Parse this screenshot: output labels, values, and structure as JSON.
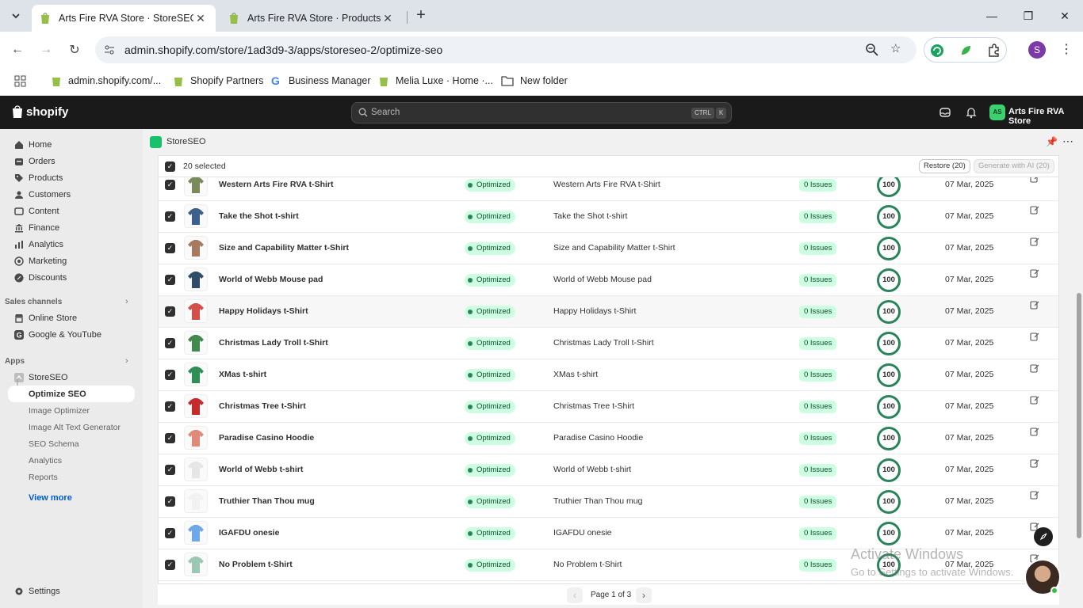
{
  "browser": {
    "tabs": [
      {
        "title": "Arts Fire RVA Store · StoreSEO ·",
        "active": true
      },
      {
        "title": "Arts Fire RVA Store · Products ·",
        "active": false
      }
    ],
    "url": "admin.shopify.com/store/1ad3d9-3/apps/storeseo-2/optimize-seo",
    "profile_initial": "S",
    "bookmarks": [
      {
        "label": "admin.shopify.com/...",
        "icon": "shopify-bag-icon"
      },
      {
        "label": "Shopify Partners",
        "icon": "shopify-bag-icon"
      },
      {
        "label": "Business Manager",
        "icon": "google-g-icon"
      },
      {
        "label": "Melia Luxe · Home ·...",
        "icon": "shopify-bag-icon"
      },
      {
        "label": "New folder",
        "icon": "folder-icon"
      }
    ]
  },
  "shopify": {
    "logo_text": "shopify",
    "search_placeholder": "Search",
    "kbd1": "CTRL",
    "kbd2": "K",
    "store_badge": "AS",
    "store_name": "Arts Fire RVA Store"
  },
  "sidebar": {
    "main": [
      {
        "label": "Home",
        "icon": "home-icon"
      },
      {
        "label": "Orders",
        "icon": "orders-icon"
      },
      {
        "label": "Products",
        "icon": "tag-icon"
      },
      {
        "label": "Customers",
        "icon": "person-icon"
      },
      {
        "label": "Content",
        "icon": "content-icon"
      },
      {
        "label": "Finance",
        "icon": "bank-icon"
      },
      {
        "label": "Analytics",
        "icon": "bar-chart-icon"
      },
      {
        "label": "Marketing",
        "icon": "target-icon"
      },
      {
        "label": "Discounts",
        "icon": "discount-icon"
      }
    ],
    "sales_channels_header": "Sales channels",
    "sales_channels": [
      {
        "label": "Online Store",
        "icon": "store-icon"
      },
      {
        "label": "Google & YouTube",
        "icon": "google-icon"
      }
    ],
    "apps_header": "Apps",
    "app_name": "StoreSEO",
    "app_items": [
      "Optimize SEO",
      "Image Optimizer",
      "Image Alt Text Generator",
      "SEO Schema",
      "Analytics",
      "Reports"
    ],
    "selected_item": "Optimize SEO",
    "view_more": "View more",
    "settings": "Settings"
  },
  "app": {
    "title": "StoreSEO",
    "selected_count": "20 selected",
    "restore_label": "Restore (20)",
    "generate_label": "Generate with AI (20)",
    "status_label": "Optimized",
    "issues_label": "0 Issues",
    "score": "100",
    "page_label": "Page 1 of 3",
    "products": [
      {
        "name": "Western Arts Fire RVA t-Shirt",
        "meta": "Western Arts Fire RVA t-Shirt",
        "date": "07 Mar, 2025",
        "color": "#7a8a5a"
      },
      {
        "name": "Take the Shot t-shirt",
        "meta": "Take the Shot t-shirt",
        "date": "07 Mar, 2025",
        "color": "#3d5f8c"
      },
      {
        "name": "Size and Capability Matter t-Shirt",
        "meta": "Size and Capability Matter t-Shirt",
        "date": "07 Mar, 2025",
        "color": "#a57a5e"
      },
      {
        "name": "World of Webb Mouse pad",
        "meta": "World of Webb Mouse pad",
        "date": "07 Mar, 2025",
        "color": "#2f4d68"
      },
      {
        "name": "Happy Holidays t-Shirt",
        "meta": "Happy Holidays t-Shirt",
        "date": "07 Mar, 2025",
        "color": "#d2504a"
      },
      {
        "name": "Christmas Lady Troll t-Shirt",
        "meta": "Christmas Lady Troll t-Shirt",
        "date": "07 Mar, 2025",
        "color": "#3f8a4c"
      },
      {
        "name": "XMas t-shirt",
        "meta": "XMas t-shirt",
        "date": "07 Mar, 2025",
        "color": "#2f8f55"
      },
      {
        "name": "Christmas Tree t-Shirt",
        "meta": "Christmas Tree t-Shirt",
        "date": "07 Mar, 2025",
        "color": "#c42c2c"
      },
      {
        "name": "Paradise Casino Hoodie",
        "meta": "Paradise Casino Hoodie",
        "date": "07 Mar, 2025",
        "color": "#e08a7a"
      },
      {
        "name": "World of Webb t-shirt",
        "meta": "World of Webb t-shirt",
        "date": "07 Mar, 2025",
        "color": "#e6e6e6"
      },
      {
        "name": "Truthier Than Thou mug",
        "meta": "Truthier Than Thou mug",
        "date": "07 Mar, 2025",
        "color": "#f2f2f2"
      },
      {
        "name": "IGAFDU onesie",
        "meta": "IGAFDU onesie",
        "date": "07 Mar, 2025",
        "color": "#6fa8e8"
      },
      {
        "name": "No Problem t-Shirt",
        "meta": "No Problem t-Shirt",
        "date": "07 Mar, 2025",
        "color": "#9bc8b4"
      }
    ]
  },
  "overlay": {
    "watermark_title": "Activate Windows",
    "watermark_sub": "Go to Settings to activate Windows."
  }
}
